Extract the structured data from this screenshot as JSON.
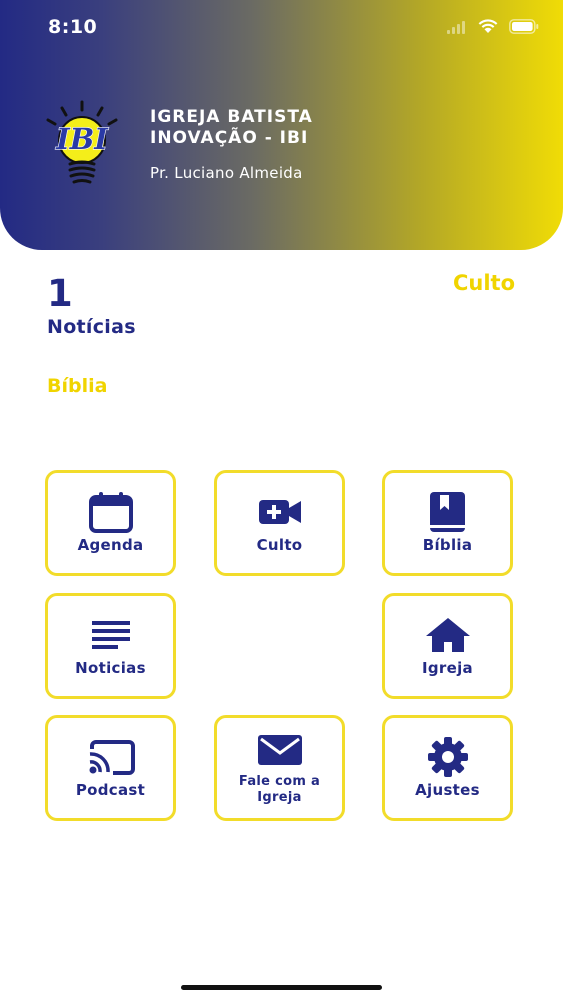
{
  "status_bar": {
    "time": "8:10"
  },
  "header": {
    "church_name_line1": "IGREJA BATISTA",
    "church_name_line2": "INOVAÇÃO - IBI",
    "pastor": "Pr. Luciano Almeida",
    "logo_icon": "ibi-lightbulb-logo",
    "gradient_start": "#232a84",
    "gradient_end": "#f0dc06"
  },
  "summary": {
    "count": "1",
    "count_label": "Notícias",
    "culto": "Culto",
    "biblia": "Bíblia"
  },
  "menu": {
    "agenda": "Agenda",
    "culto": "Culto",
    "biblia": "Bíblia",
    "noticias": "Noticias",
    "igreja": "Igreja",
    "podcast": "Podcast",
    "fale_line1": "Fale com a",
    "fale_line2": "Igreja",
    "ajustes": "Ajustes"
  },
  "colors": {
    "primary": "#232a84",
    "accent": "#f0d400",
    "tile_border": "#f2dc2a"
  }
}
